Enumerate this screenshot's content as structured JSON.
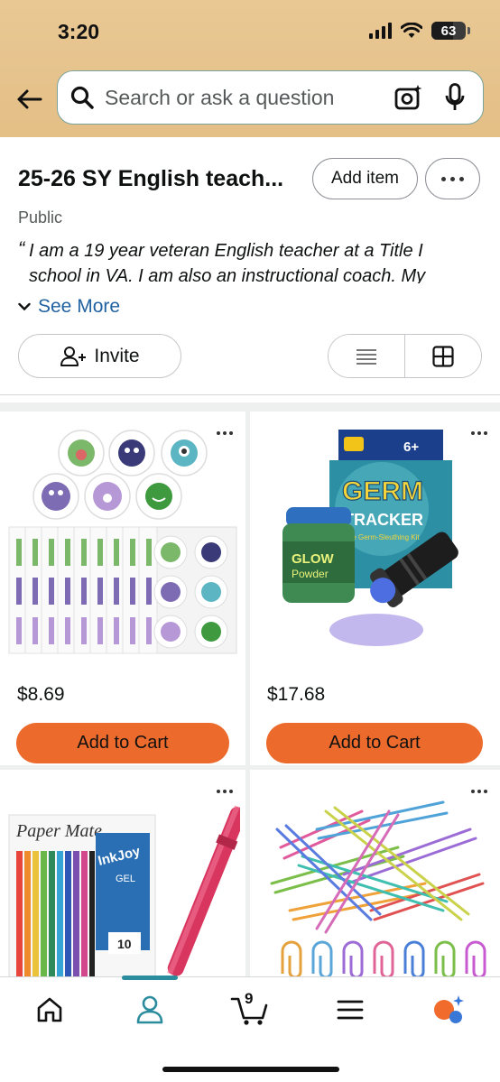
{
  "status_bar": {
    "time": "3:20",
    "battery": "63"
  },
  "search": {
    "placeholder": "Search or ask a question"
  },
  "list": {
    "title": "25-26 SY English teach...",
    "add_item_label": "Add item",
    "privacy": "Public",
    "description": "I am a 19 year veteran English teacher at a Title I school in VA. I am also an instructional coach. My",
    "see_more_label": "See More",
    "invite_label": "Invite"
  },
  "products": [
    {
      "name": "Germ stickers",
      "price": "$8.69",
      "button_label": "Add to Cart"
    },
    {
      "name": "Germ Tracker kit",
      "price": "$17.68",
      "button_label": "Add to Cart"
    },
    {
      "name": "Paper Mate InkJoy Gel pens",
      "price": "",
      "button_label": ""
    },
    {
      "name": "Colored paper clips",
      "price": "",
      "button_label": ""
    }
  ],
  "product_text": {
    "germ_brand": "GERM",
    "germ_title": "TRACKER",
    "germ_sub": "The Germ-Sleuthing Kit",
    "age": "6+",
    "glow": "GLOW",
    "powder": "Powder",
    "papermate": "Paper Mate",
    "inkjoy": "InkJoy",
    "gel": "GEL",
    "pen_count": "10"
  },
  "bottom_nav": {
    "cart_count": "9"
  },
  "colors": {
    "header": "#e6c28a",
    "accent_teal": "#2a8c9c",
    "cart_button": "#ec6b2c",
    "link": "#2162a1"
  }
}
